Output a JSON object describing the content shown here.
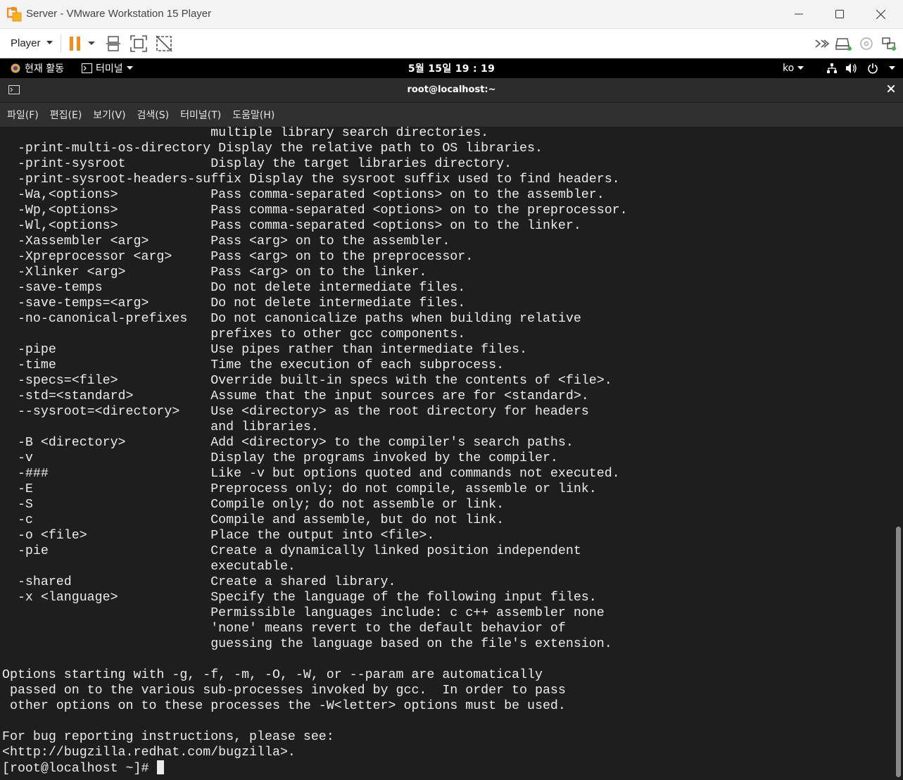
{
  "window": {
    "title": "Server - VMware Workstation 15 Player",
    "logo_icon": "vmware-logo-icon",
    "controls": [
      "minimize-icon",
      "maximize-icon",
      "close-icon"
    ]
  },
  "toolbar": {
    "player_label": "Player",
    "buttons": [
      "pause-icon",
      "dropdown-arrow-icon",
      "send-ctrl-alt-del-icon",
      "fit-guest-icon",
      "unity-icon"
    ],
    "right_icons": [
      "more-icon",
      "hard-disk-icon",
      "cd-icon",
      "network-icon"
    ]
  },
  "gnome": {
    "activities": "현재 활동",
    "app_menu": "터미널",
    "clock": "5월 15일  19 : 19",
    "keyboard_layout": "ko"
  },
  "terminal": {
    "title": "root@localhost:~",
    "menu": [
      "파일(F)",
      "편집(E)",
      "보기(V)",
      "검색(S)",
      "터미널(T)",
      "도움말(H)"
    ],
    "lines": [
      "                           multiple library search directories.",
      "  -print-multi-os-directory Display the relative path to OS libraries.",
      "  -print-sysroot           Display the target libraries directory.",
      "  -print-sysroot-headers-suffix Display the sysroot suffix used to find headers.",
      "  -Wa,<options>            Pass comma-separated <options> on to the assembler.",
      "  -Wp,<options>            Pass comma-separated <options> on to the preprocessor.",
      "  -Wl,<options>            Pass comma-separated <options> on to the linker.",
      "  -Xassembler <arg>        Pass <arg> on to the assembler.",
      "  -Xpreprocessor <arg>     Pass <arg> on to the preprocessor.",
      "  -Xlinker <arg>           Pass <arg> on to the linker.",
      "  -save-temps              Do not delete intermediate files.",
      "  -save-temps=<arg>        Do not delete intermediate files.",
      "  -no-canonical-prefixes   Do not canonicalize paths when building relative",
      "                           prefixes to other gcc components.",
      "  -pipe                    Use pipes rather than intermediate files.",
      "  -time                    Time the execution of each subprocess.",
      "  -specs=<file>            Override built-in specs with the contents of <file>.",
      "  -std=<standard>          Assume that the input sources are for <standard>.",
      "  --sysroot=<directory>    Use <directory> as the root directory for headers",
      "                           and libraries.",
      "  -B <directory>           Add <directory> to the compiler's search paths.",
      "  -v                       Display the programs invoked by the compiler.",
      "  -###                     Like -v but options quoted and commands not executed.",
      "  -E                       Preprocess only; do not compile, assemble or link.",
      "  -S                       Compile only; do not assemble or link.",
      "  -c                       Compile and assemble, but do not link.",
      "  -o <file>                Place the output into <file>.",
      "  -pie                     Create a dynamically linked position independent",
      "                           executable.",
      "  -shared                  Create a shared library.",
      "  -x <language>            Specify the language of the following input files.",
      "                           Permissible languages include: c c++ assembler none",
      "                           'none' means revert to the default behavior of",
      "                           guessing the language based on the file's extension.",
      "",
      "Options starting with -g, -f, -m, -O, -W, or --param are automatically",
      " passed on to the various sub-processes invoked by gcc.  In order to pass",
      " other options on to these processes the -W<letter> options must be used.",
      "",
      "For bug reporting instructions, please see:",
      "<http://bugzilla.redhat.com/bugzilla>."
    ],
    "prompt": "[root@localhost ~]# "
  },
  "colors": {
    "terminal_bg": "#1e1e1e",
    "terminal_fg": "#ececec",
    "pause_orange": "#f28c1e",
    "gnome_bar": "#000000"
  }
}
